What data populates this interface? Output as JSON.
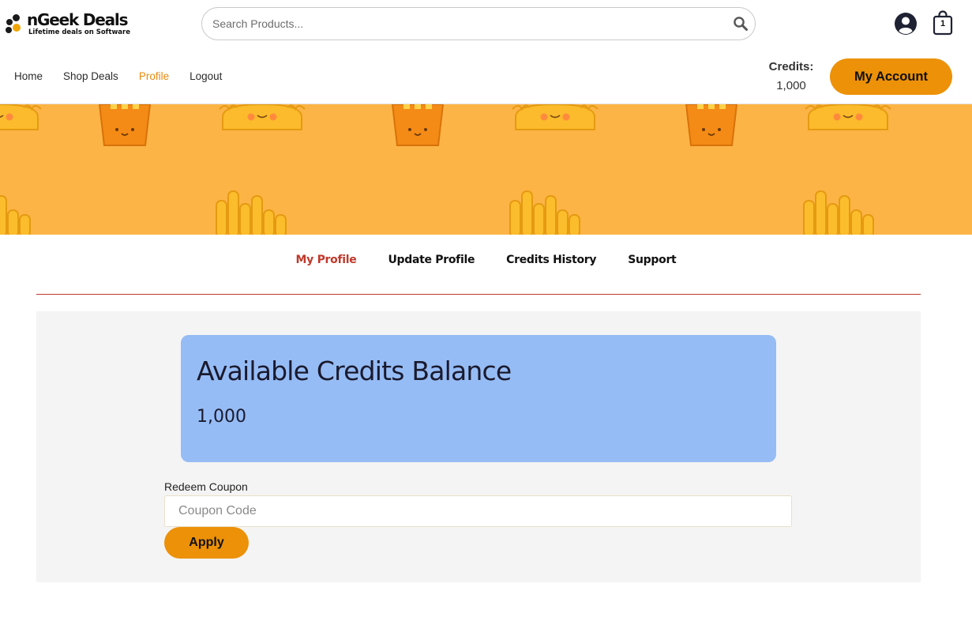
{
  "brand": {
    "name": "nGeek Deals",
    "tagline": "Lifetime deals on Software",
    "colors": {
      "accent": "#ec9108",
      "nav_active": "#e88a0c",
      "tab_active": "#c0392b",
      "card": "#96bcf5",
      "banner": "#fdb446"
    }
  },
  "search": {
    "placeholder": "Search Products...",
    "value": "",
    "icon": "search-icon"
  },
  "header": {
    "account_icon": "user-circle-icon",
    "cart_icon": "shopping-bag-icon",
    "cart_count": "1",
    "credits_label": "Credits:",
    "credits_value": "1,000",
    "my_account_label": "My Account"
  },
  "nav": {
    "items": [
      {
        "label": "Home",
        "active": false
      },
      {
        "label": "Shop Deals",
        "active": false
      },
      {
        "label": "Profile",
        "active": true
      },
      {
        "label": "Logout",
        "active": false
      }
    ]
  },
  "banner": {
    "pattern": "cartoon tacos and fries"
  },
  "tabs": {
    "items": [
      {
        "label": "My Profile",
        "active": true
      },
      {
        "label": "Update Profile",
        "active": false
      },
      {
        "label": "Credits History",
        "active": false
      },
      {
        "label": "Support",
        "active": false
      }
    ]
  },
  "balance": {
    "title": "Available Credits Balance",
    "value": "1,000"
  },
  "coupon": {
    "label": "Redeem Coupon",
    "placeholder": "Coupon Code",
    "value": "",
    "apply_label": "Apply"
  }
}
